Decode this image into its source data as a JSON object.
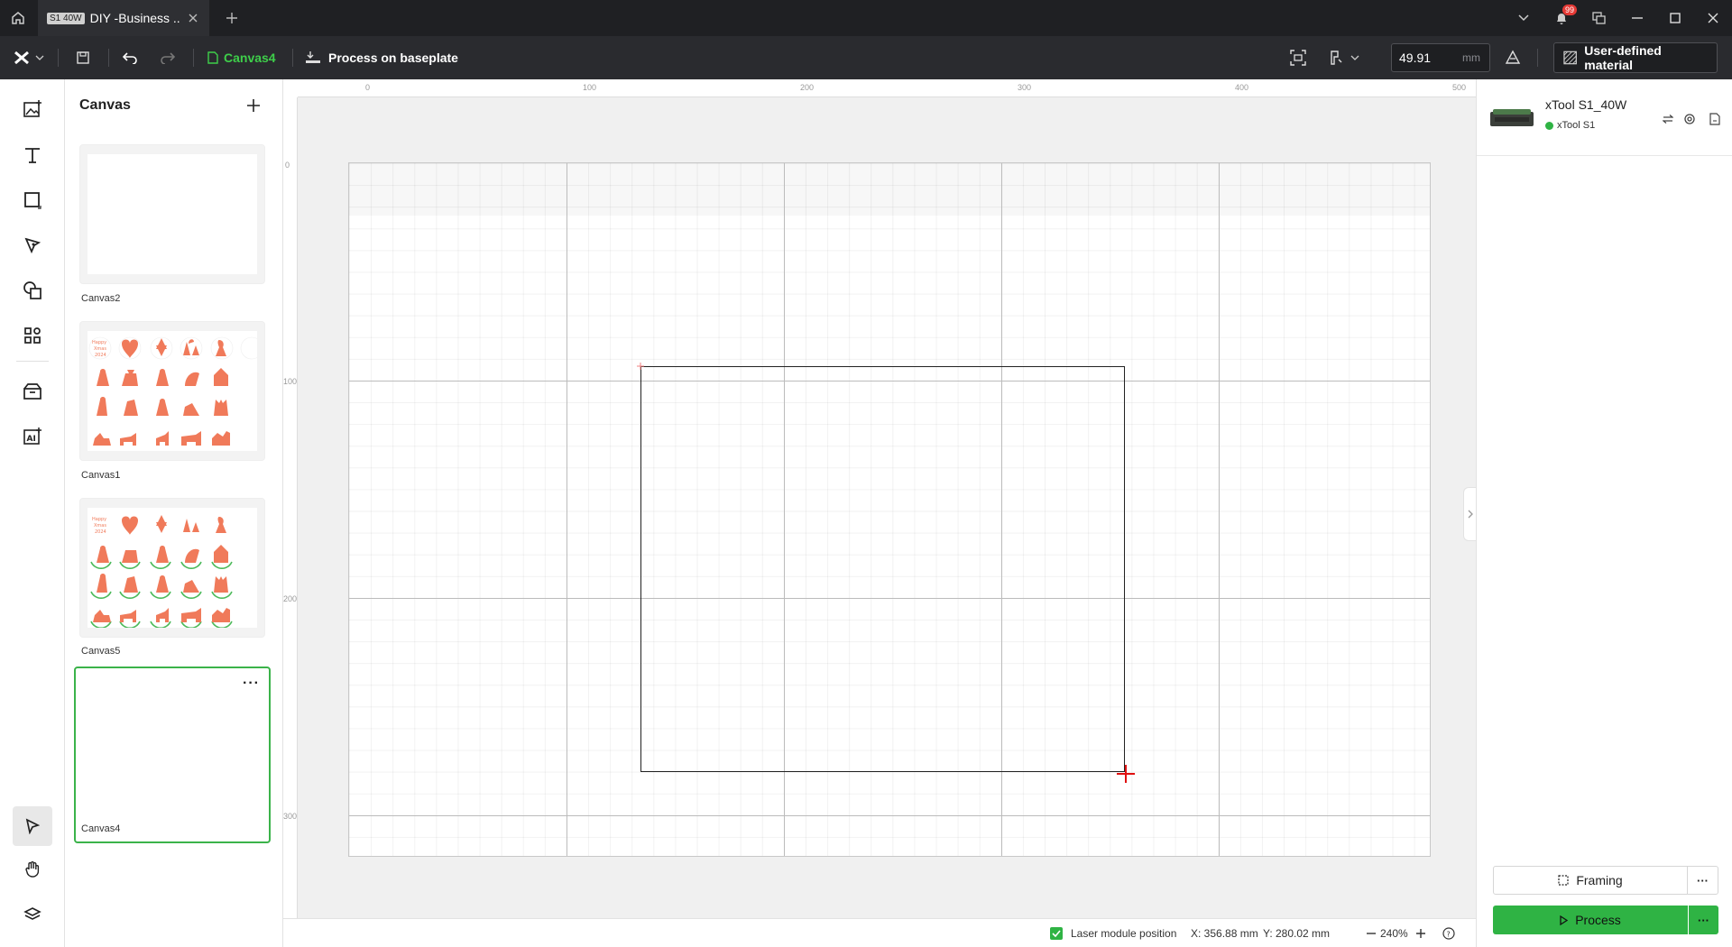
{
  "titlebar": {
    "tab_badge": "S1 40W",
    "tab_title": "DIY -Business ...",
    "notification_count": "99"
  },
  "toolbar": {
    "canvas_name": "Canvas4",
    "process_mode": "Process on baseplate",
    "thickness_value": "49.91",
    "thickness_unit": "mm",
    "material_label": "User-defined material"
  },
  "panel": {
    "title": "Canvas",
    "canvases": [
      {
        "label": "Canvas2"
      },
      {
        "label": "Canvas1"
      },
      {
        "label": "Canvas5"
      },
      {
        "label": "Canvas4"
      }
    ]
  },
  "rulers": {
    "horizontal": [
      "0",
      "100",
      "200",
      "300",
      "400",
      "500"
    ],
    "vertical": [
      "0",
      "100",
      "200",
      "300"
    ]
  },
  "status": {
    "laser_label": "Laser module position",
    "x": "X: 356.88 mm",
    "y": "Y: 280.02 mm",
    "zoom": "240%"
  },
  "device": {
    "name": "xTool S1_40W",
    "status": "xTool S1"
  },
  "actions": {
    "framing": "Framing",
    "process": "Process"
  },
  "colors": {
    "accent_green": "#2fb344",
    "design_orange": "#f07a5a",
    "crosshair_red": "#e01010"
  }
}
